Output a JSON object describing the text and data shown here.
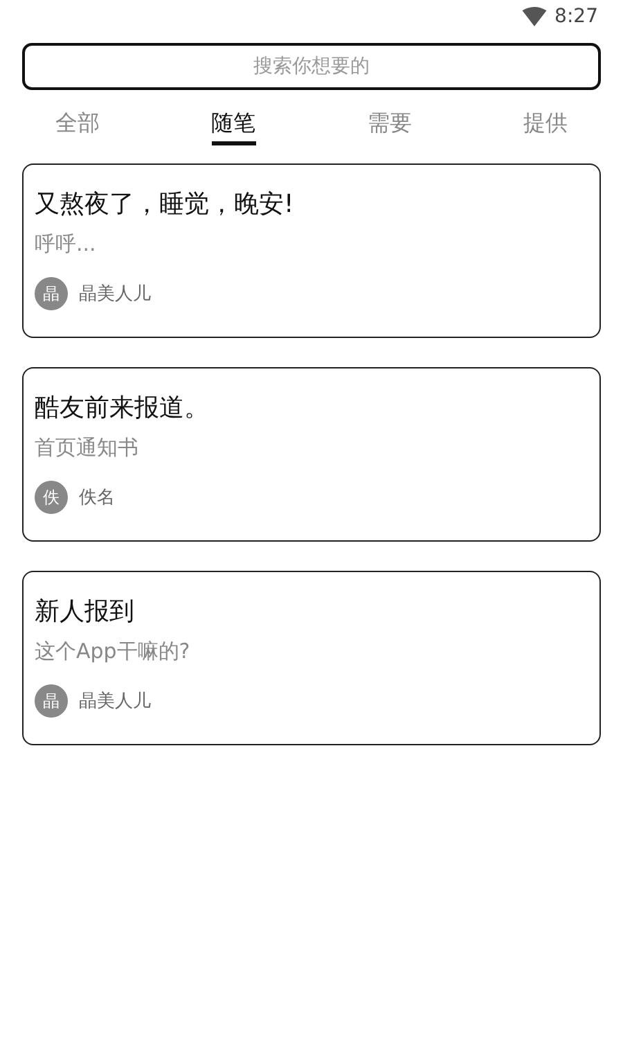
{
  "status_bar": {
    "time": "8:27"
  },
  "search": {
    "placeholder": "搜索你想要的"
  },
  "tabs": [
    {
      "label": "全部",
      "selected": false
    },
    {
      "label": "随笔",
      "selected": true
    },
    {
      "label": "需要",
      "selected": false
    },
    {
      "label": "提供",
      "selected": false
    }
  ],
  "posts": [
    {
      "title": "又熬夜了，睡觉，晚安!",
      "excerpt": "呼呼...",
      "avatar": "晶",
      "author": "晶美人儿"
    },
    {
      "title": "酷友前来报道。",
      "excerpt": "首页通知书",
      "avatar": "佚",
      "author": "佚名"
    },
    {
      "title": "新人报到",
      "excerpt": "这个App干嘛的?",
      "avatar": "晶",
      "author": "晶美人儿"
    }
  ]
}
